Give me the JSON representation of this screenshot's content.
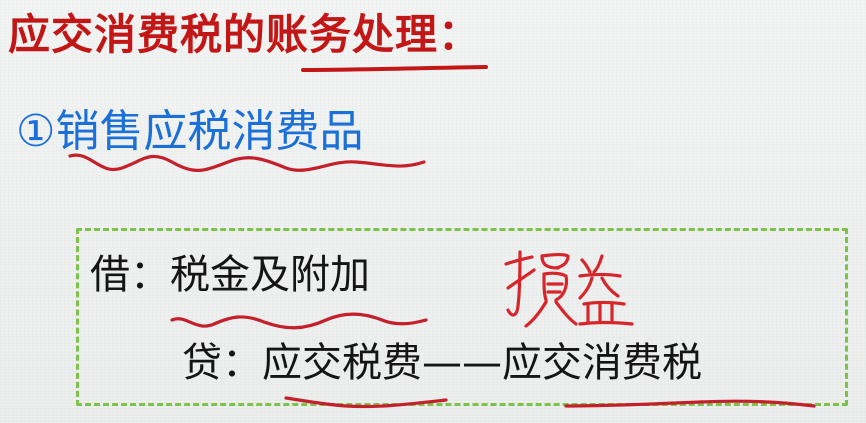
{
  "title": {
    "prefix": "应交消费税的",
    "highlight": "账务处理",
    "suffix": "："
  },
  "subtitle": {
    "number": "①",
    "text": "销售应税消费品"
  },
  "journal_entry": {
    "debit_label": "借：",
    "debit_account": "税金及附加",
    "credit_label": "贷：",
    "credit_account": "应交税费",
    "credit_separator": "——",
    "credit_subaccount": "应交消费税"
  },
  "annotations": {
    "handwritten_note": "损益",
    "ink_color": "#d7262b",
    "underline_color_title": "#c31616"
  },
  "colors": {
    "title": "#c31616",
    "subtitle": "#1b6fd9",
    "body_text": "#151515",
    "box_border": "#7cc34a",
    "background": "#eceeed"
  }
}
